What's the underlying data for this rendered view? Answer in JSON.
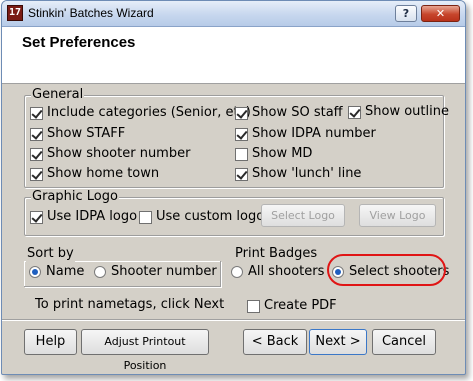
{
  "window": {
    "title": "Stinkin' Batches Wizard",
    "icon_text": "17",
    "help_button": "?",
    "close_button": "✕"
  },
  "header": {
    "title": "Set Preferences"
  },
  "general": {
    "legend": "General",
    "options": [
      {
        "label": "Include categories (Senior, etc)",
        "checked": true
      },
      {
        "label": "Show STAFF",
        "checked": true
      },
      {
        "label": "Show shooter number",
        "checked": true
      },
      {
        "label": "Show home town",
        "checked": true
      },
      {
        "label": "Show SO staff",
        "checked": true
      },
      {
        "label": "Show IDPA number",
        "checked": true
      },
      {
        "label": "Show MD",
        "checked": false
      },
      {
        "label": "Show 'lunch' line",
        "checked": true
      },
      {
        "label": "Show outline",
        "checked": true
      }
    ]
  },
  "graphic_logo": {
    "legend": "Graphic Logo",
    "use_idpa_logo": "Use IDPA logo",
    "use_custom_logo": "Use custom logo",
    "select_logo": "Select Logo",
    "view_logo": "View Logo"
  },
  "sort_by": {
    "legend": "Sort by",
    "name": "Name",
    "shooter_number": "Shooter number",
    "selected": "Name"
  },
  "print_badges": {
    "legend": "Print Badges",
    "all_shooters": "All shooters",
    "select_shooters": "Select shooters",
    "selected": "Select shooters"
  },
  "instructions": "To print nametags, click Next",
  "create_pdf": {
    "label": "Create PDF",
    "checked": false
  },
  "footer": {
    "help": "Help",
    "adjust": "Adjust Printout Position",
    "back": "< Back",
    "next": "Next >",
    "cancel": "Cancel"
  }
}
